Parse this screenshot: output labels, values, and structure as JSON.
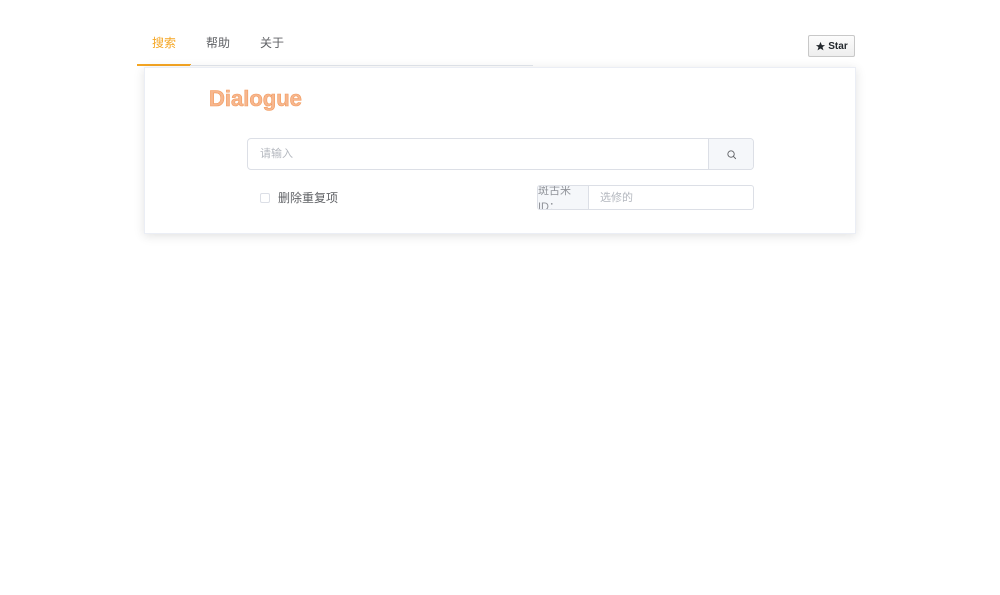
{
  "nav": {
    "tabs": [
      {
        "label": "搜索",
        "active": true
      },
      {
        "label": "帮助",
        "active": false
      },
      {
        "label": "关于",
        "active": false
      }
    ],
    "star_label": "Star",
    "accent_color": "#f5a623"
  },
  "card": {
    "logo_text": "Dialogue",
    "search": {
      "placeholder": "请输入",
      "value": "",
      "button_icon": "search-icon"
    },
    "dedupe": {
      "label": "删除重复项",
      "checked": false
    },
    "id_filter": {
      "prefix": "斑古米ID：",
      "placeholder": "选修的",
      "value": ""
    }
  }
}
